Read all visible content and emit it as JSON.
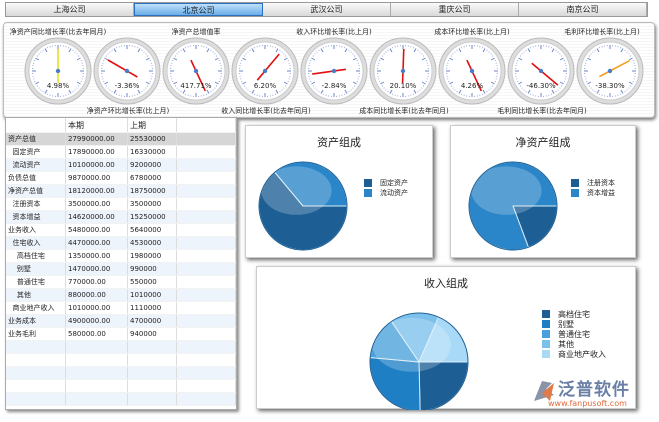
{
  "tabs": [
    {
      "label": "上海公司"
    },
    {
      "label": "北京公司"
    },
    {
      "label": "武汉公司"
    },
    {
      "label": "重庆公司"
    },
    {
      "label": "南京公司"
    }
  ],
  "active_tab": 1,
  "gauge_titles_top": [
    "净资产同比增长率(比去年同月)",
    "净资产总增值率",
    "收入环比增长率(比上月)",
    "成本环比增长率(比上月)",
    "毛利环比增长率(比上月)"
  ],
  "gauge_titles_bottom": [
    "净资产环比增长率(比上月)",
    "收入同比增长率(比去年同月)",
    "成本同比增长率(比去年同月)",
    "毛利同比增长率(比去年同月)"
  ],
  "gauges": [
    {
      "value": "4.98%",
      "needle_deg": 0,
      "color": "#e8e020"
    },
    {
      "value": "-3.36%",
      "needle_deg": 300,
      "color": "#e01010"
    },
    {
      "value": "417.71%",
      "needle_deg": 155,
      "color": "#e01010"
    },
    {
      "value": "6.20%",
      "needle_deg": 40,
      "color": "#e01010"
    },
    {
      "value": "-2.84%",
      "needle_deg": 262,
      "color": "#e01010"
    },
    {
      "value": "20.10%",
      "needle_deg": 2,
      "color": "#e01010"
    },
    {
      "value": "4.26%",
      "needle_deg": 155,
      "color": "#e01010"
    },
    {
      "value": "-46.30%",
      "needle_deg": 130,
      "color": "#e01010"
    },
    {
      "value": "-38.30%",
      "needle_deg": 62,
      "color": "#f0a020"
    }
  ],
  "table": {
    "headers": [
      "",
      "本期",
      "上期",
      ""
    ],
    "rows": [
      [
        "资产总值",
        "27990000.00",
        "25530000"
      ],
      [
        "  固定资产",
        "17890000.00",
        "16330000"
      ],
      [
        "  流动资产",
        "10100000.00",
        "9200000"
      ],
      [
        "负债总值",
        "9870000.00",
        "6780000"
      ],
      [
        "净资产总值",
        "18120000.00",
        "18750000"
      ],
      [
        "  注册资本",
        "3500000.00",
        "3500000"
      ],
      [
        "  资本增益",
        "14620000.00",
        "15250000"
      ],
      [
        "业务收入",
        "5480000.00",
        "5640000"
      ],
      [
        "  住宅收入",
        "4470000.00",
        "4530000"
      ],
      [
        "    高档住宅",
        "1350000.00",
        "1980000"
      ],
      [
        "    别墅",
        "1470000.00",
        "990000"
      ],
      [
        "    普通住宅",
        "770000.00",
        "550000"
      ],
      [
        "    其他",
        "880000.00",
        "1010000"
      ],
      [
        "  商业地产收入",
        "1010000.00",
        "1110000"
      ],
      [
        "业务成本",
        "4900000.00",
        "4700000"
      ],
      [
        "业务毛利",
        "580000.00",
        "940000"
      ]
    ]
  },
  "chart_data": [
    {
      "type": "pie",
      "title": "资产组成",
      "labels": [
        "固定资产",
        "流动资产"
      ],
      "values": [
        17890000,
        10100000
      ],
      "colors": [
        "#1d5f95",
        "#2a86c8"
      ]
    },
    {
      "type": "pie",
      "title": "净资产组成",
      "labels": [
        "注册资本",
        "资本增益"
      ],
      "values": [
        3500000,
        14620000
      ],
      "colors": [
        "#1d5f95",
        "#2a86c8"
      ]
    },
    {
      "type": "pie",
      "title": "收入组成",
      "labels": [
        "高档住宅",
        "别墅",
        "普通住宅",
        "其他",
        "商业地产收入"
      ],
      "values": [
        1350000,
        1470000,
        770000,
        880000,
        1010000
      ],
      "colors": [
        "#1d5f95",
        "#1f7fc4",
        "#4aa0dc",
        "#7cc0ec",
        "#a8daf7"
      ]
    }
  ],
  "logo": {
    "name": "泛普软件",
    "url": "www.fanpusoft.com"
  }
}
